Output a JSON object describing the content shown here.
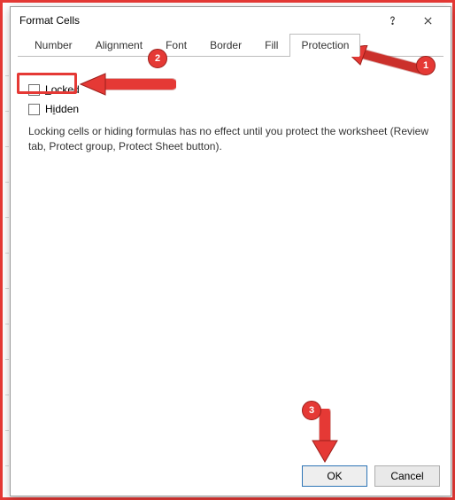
{
  "titlebar": {
    "title": "Format Cells",
    "help_icon": "help-icon",
    "close_icon": "close-icon"
  },
  "tabs": {
    "items": [
      {
        "id": "number",
        "label": "Number"
      },
      {
        "id": "alignment",
        "label": "Alignment"
      },
      {
        "id": "font",
        "label": "Font"
      },
      {
        "id": "border",
        "label": "Border"
      },
      {
        "id": "fill",
        "label": "Fill"
      },
      {
        "id": "protection",
        "label": "Protection"
      }
    ],
    "active": "protection"
  },
  "protection": {
    "locked": {
      "label": "Locked",
      "checked": false,
      "accel": "L"
    },
    "hidden": {
      "label": "Hidden",
      "checked": false,
      "accel": "i"
    },
    "info": "Locking cells or hiding formulas has no effect until you protect the worksheet (Review tab, Protect group, Protect Sheet button)."
  },
  "buttons": {
    "ok": {
      "label": "OK"
    },
    "cancel": {
      "label": "Cancel"
    }
  },
  "annotations": {
    "step1": "1",
    "step2": "2",
    "step3": "3",
    "color": "#e53935"
  }
}
